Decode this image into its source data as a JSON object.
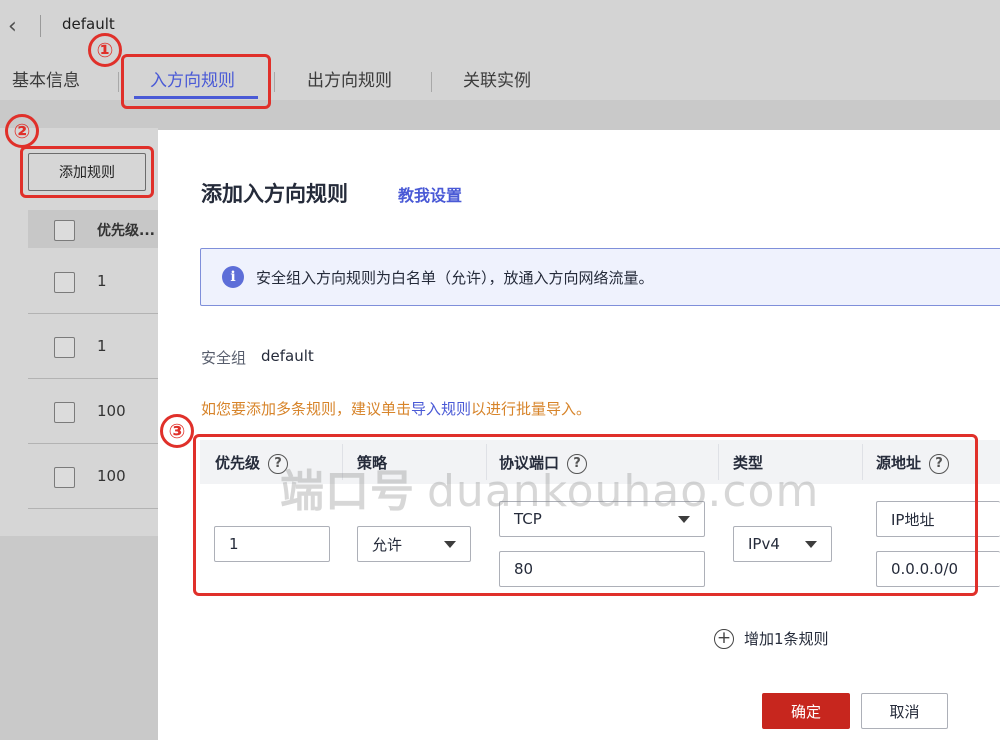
{
  "header": {
    "title": "default",
    "tabs": [
      {
        "label": "基本信息"
      },
      {
        "label": "入方向规则"
      },
      {
        "label": "出方向规则"
      },
      {
        "label": "关联实例"
      }
    ]
  },
  "list": {
    "add_button": "添加规则",
    "column_priority": "优先级...",
    "rows": [
      {
        "priority": "1"
      },
      {
        "priority": "1"
      },
      {
        "priority": "100"
      },
      {
        "priority": "100"
      }
    ]
  },
  "drawer": {
    "title": "添加入方向规则",
    "teach_link": "教我设置",
    "info": "安全组入方向规则为白名单（允许），放通入方向网络流量。",
    "sg_label": "安全组",
    "sg_value": "default",
    "hint_prefix": "如您要添加多条规则，建议单击",
    "hint_link": "导入规则",
    "hint_suffix": "以进行批量导入。",
    "columns": {
      "priority": "优先级",
      "policy": "策略",
      "protocol_port": "协议端口",
      "type": "类型",
      "source": "源地址"
    },
    "rule": {
      "priority": "1",
      "policy": "允许",
      "protocol": "TCP",
      "port": "80",
      "type": "IPv4",
      "source_kind": "IP地址",
      "source_ip": "0.0.0.0/0"
    },
    "add_rule": "增加1条规则",
    "ok": "确定",
    "cancel": "取消"
  },
  "annotations": {
    "mark1": "①",
    "mark2": "②",
    "mark3": "③"
  },
  "watermark": {
    "cn": "端口号",
    "en": "duankouhao.com"
  },
  "colors": {
    "accent": "#4a5ad6",
    "confirm": "#c7261e",
    "highlight": "#e0302a",
    "hint": "#d7842a"
  }
}
